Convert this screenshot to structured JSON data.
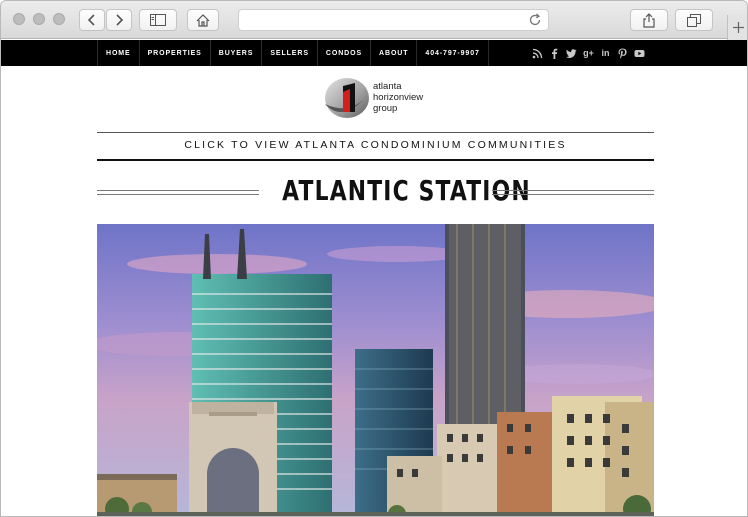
{
  "browser": {
    "icons": [
      "back-icon",
      "forward-icon",
      "sidebar-icon",
      "home-icon",
      "reload-icon",
      "share-icon",
      "tabs-icon",
      "new-tab-icon"
    ]
  },
  "nav": {
    "items": [
      "HOME",
      "PROPERTIES",
      "BUYERS",
      "SELLERS",
      "CONDOS",
      "ABOUT",
      "404-797-9907"
    ],
    "social": [
      "rss-icon",
      "facebook-icon",
      "twitter-icon",
      "google-plus-icon",
      "linkedin-icon",
      "pinterest-icon",
      "youtube-icon"
    ]
  },
  "logo": {
    "line1": "atlanta",
    "line2": "horizonview",
    "line3": "group"
  },
  "cta": "CLICK TO VIEW ATLANTA CONDOMINIUM COMMUNITIES",
  "page_title": "ATLANTIC STATION",
  "colors": {
    "navbar": "#000000",
    "accent_red": "#d0201b",
    "sky": "#8f96d6"
  }
}
